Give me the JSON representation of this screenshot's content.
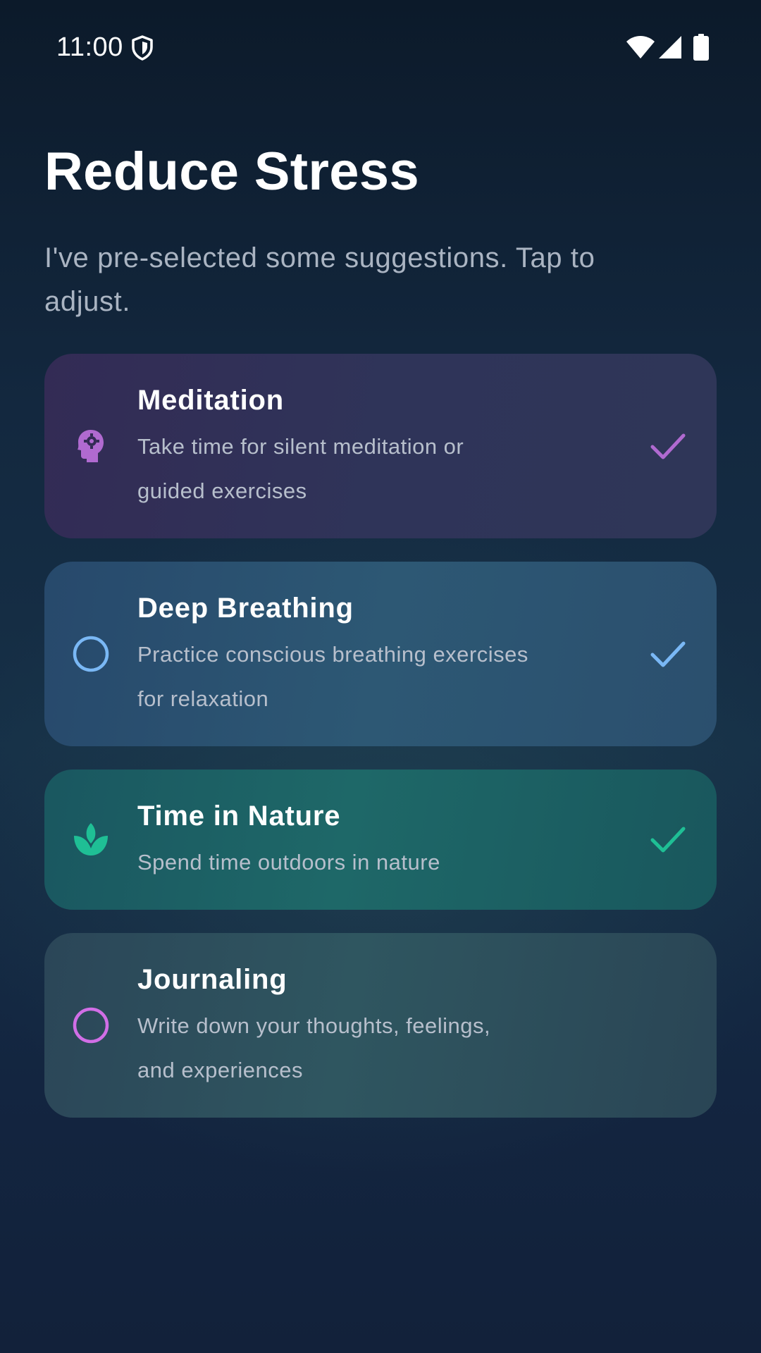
{
  "status_bar": {
    "time": "11:00",
    "icons": [
      "shield-icon",
      "wifi-icon",
      "cell-signal-icon",
      "battery-icon"
    ]
  },
  "header": {
    "title": "Reduce Stress",
    "subtitle": "I've pre-selected some suggestions. Tap to adjust."
  },
  "suggestions": [
    {
      "title": "Meditation",
      "description": "Take time for silent meditation or guided exercises",
      "icon": "head-gear-icon",
      "accent": "#b06ad0",
      "selected": true
    },
    {
      "title": "Deep Breathing",
      "description": "Practice conscious breathing exercises for relaxation",
      "icon": "circle-outline-icon",
      "accent": "#7ab8f5",
      "selected": true
    },
    {
      "title": "Time in Nature",
      "description": "Spend time outdoors in nature",
      "icon": "leaf-spa-icon",
      "accent": "#1fbf95",
      "selected": true
    },
    {
      "title": "Journaling",
      "description": "Write down your thoughts, feelings, and experiences",
      "icon": "circle-outline-icon",
      "accent": "#d16ee6",
      "selected": false
    }
  ]
}
